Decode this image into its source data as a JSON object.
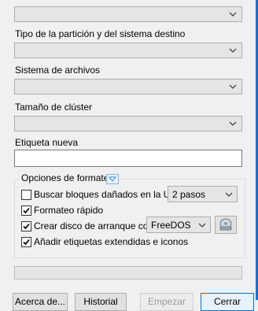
{
  "fields": {
    "partition_scheme": {
      "label": "Tipo de la partición y del sistema destino",
      "value": ""
    },
    "filesystem": {
      "label": "Sistema de archivos",
      "value": ""
    },
    "cluster_size": {
      "label": "Tamaño de clúster",
      "value": ""
    },
    "volume_label": {
      "label": "Etiqueta nueva",
      "value": ""
    }
  },
  "format_options": {
    "title": "Opciones de formateo",
    "bad_blocks": {
      "label": "Buscar bloques dañados en la USB:",
      "checked": false,
      "passes_value": "2 pasos"
    },
    "quick_format": {
      "label": "Formateo rápido",
      "checked": true
    },
    "bootable": {
      "label": "Crear disco de arranque con:",
      "checked": true,
      "boot_type_value": "FreeDOS"
    },
    "extended_label": {
      "label": "Añadir etiquetas extendidas e iconos",
      "checked": true
    }
  },
  "progress": {
    "value": 0
  },
  "buttons": {
    "about": "Acerca de...",
    "log": "Historial",
    "start": "Empezar",
    "close": "Cerrar"
  },
  "colors": {
    "accent": "#1f6fc9",
    "check": "#000000"
  }
}
